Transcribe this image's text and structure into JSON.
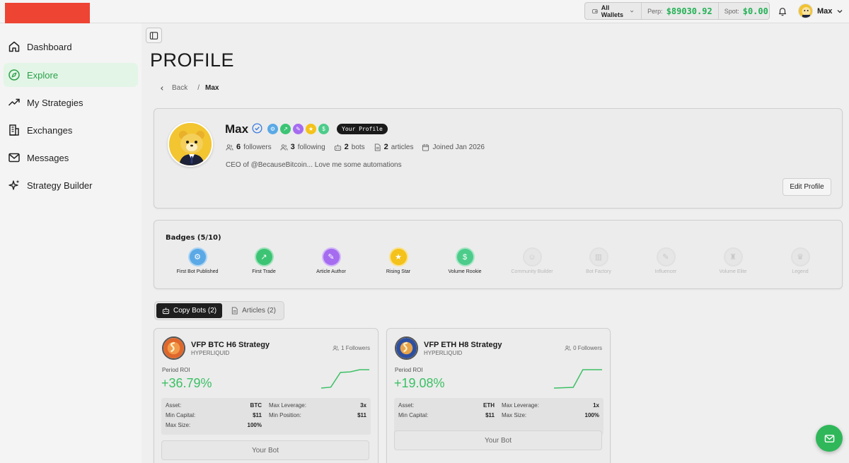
{
  "header": {
    "wallet_select": "All Wallets",
    "perp_label": "Perp:",
    "perp_value": "$89030.92",
    "spot_label": "Spot:",
    "spot_value": "$0.00",
    "user_name": "Max"
  },
  "sidebar": {
    "items": [
      {
        "label": "Dashboard",
        "icon": "home-icon"
      },
      {
        "label": "Explore",
        "icon": "compass-icon",
        "active": true
      },
      {
        "label": "My Strategies",
        "icon": "trending-up-icon"
      },
      {
        "label": "Exchanges",
        "icon": "building-icon"
      },
      {
        "label": "Messages",
        "icon": "mail-icon"
      },
      {
        "label": "Strategy Builder",
        "icon": "sparkles-icon"
      }
    ]
  },
  "page": {
    "title": "PROFILE",
    "breadcrumb_back": "Back",
    "breadcrumb_sep": "/",
    "breadcrumb_current": "Max"
  },
  "profile": {
    "name": "Max",
    "pill": "Your Profile",
    "followers_count": "6",
    "followers_label": "followers",
    "following_count": "3",
    "following_label": "following",
    "bots_count": "2",
    "bots_label": "bots",
    "articles_count": "2",
    "articles_label": "articles",
    "joined": "Joined Jan 2026",
    "bio": "CEO of @BecauseBitcoin... Love me some automations",
    "edit_button": "Edit Profile"
  },
  "badges": {
    "title": "Badges (5/10)",
    "items": [
      {
        "label": "First Bot Published",
        "icon": "robot-icon",
        "color": "#5aa9e6",
        "earned": true
      },
      {
        "label": "First Trade",
        "icon": "chart-icon",
        "color": "#3cc474",
        "earned": true
      },
      {
        "label": "Article Author",
        "icon": "pen-icon",
        "color": "#a56cf0",
        "earned": true
      },
      {
        "label": "Rising Star",
        "icon": "star-icon",
        "color": "#f4c21a",
        "earned": true
      },
      {
        "label": "Volume Rookie",
        "icon": "money-icon",
        "color": "#4ccc8a",
        "earned": true
      },
      {
        "label": "Community Builder",
        "icon": "people-icon",
        "color": "#e6e6e6",
        "earned": false
      },
      {
        "label": "Bot Factory",
        "icon": "factory-icon",
        "color": "#e6e6e6",
        "earned": false
      },
      {
        "label": "Influencer",
        "icon": "mic-icon",
        "color": "#e6e6e6",
        "earned": false
      },
      {
        "label": "Volume Elite",
        "icon": "trophy-icon",
        "color": "#e6e6e6",
        "earned": false
      },
      {
        "label": "Legend",
        "icon": "crown-icon",
        "color": "#e6e6e6",
        "earned": false
      }
    ]
  },
  "tabs": [
    {
      "label": "Copy Bots (2)",
      "active": true
    },
    {
      "label": "Articles (2)",
      "active": false
    }
  ],
  "bots": [
    {
      "name": "VFP BTC H6 Strategy",
      "exchange": "HYPERLIQUID",
      "followers": "1 Followers",
      "roi_label": "Period ROI",
      "roi": "+36.79%",
      "spark": [
        0.0,
        0.05,
        0.85,
        0.88,
        1.0,
        1.0
      ],
      "stats": {
        "asset_k": "Asset:",
        "asset_v": "BTC",
        "maxlev_k": "Max Leverage:",
        "maxlev_v": "3x",
        "mincap_k": "Min Capital:",
        "mincap_v": "$11",
        "minpos_k": "Min Position:",
        "minpos_v": "$11",
        "maxsize_k": "Max Size:",
        "maxsize_v": "100%"
      },
      "button": "Your Bot",
      "icon_color": "#e0672b"
    },
    {
      "name": "VFP ETH H8 Strategy",
      "exchange": "HYPERLIQUID",
      "followers": "0 Followers",
      "roi_label": "Period ROI",
      "roi": "+19.08%",
      "spark": [
        0.0,
        0.02,
        0.04,
        1.0,
        1.0,
        1.0
      ],
      "stats": {
        "asset_k": "Asset:",
        "asset_v": "ETH",
        "maxlev_k": "Max Leverage:",
        "maxlev_v": "1x",
        "mincap_k": "Min Capital:",
        "mincap_v": "$11",
        "maxsize_k": "Max Size:",
        "maxsize_v": "100%"
      },
      "button": "Your Bot",
      "icon_color": "#2d4fa0"
    }
  ],
  "colors": {
    "accent_green": "#2fb75a",
    "roi_green": "#3cc065",
    "logo_red": "#ee4433"
  }
}
